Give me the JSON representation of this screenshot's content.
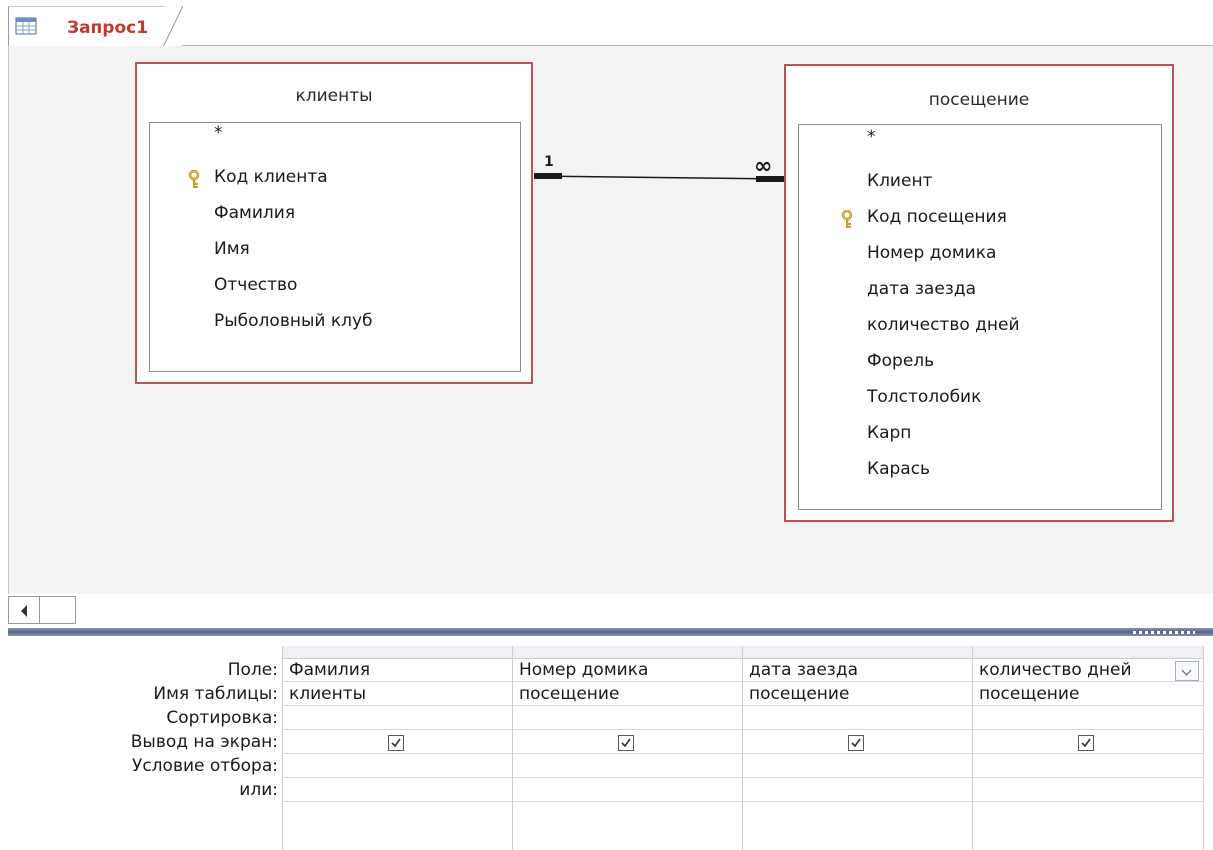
{
  "tab": {
    "title": "Запрос1"
  },
  "tables": {
    "clients": {
      "title": "клиенты",
      "fields": [
        "*",
        "Код клиента",
        "Фамилия",
        "Имя",
        "Отчество",
        "Рыболовный клуб"
      ],
      "key_field": "Код клиента"
    },
    "visits": {
      "title": "посещение",
      "fields": [
        "*",
        "Клиент",
        "Код посещения",
        "Номер домика",
        "дата заезда",
        "количество дней",
        "Форель",
        "Толстолобик",
        "Карп",
        "Карась"
      ],
      "key_field": "Код посещения"
    }
  },
  "relationship": {
    "one_label": "1",
    "many_label": "∞"
  },
  "qbe": {
    "row_labels": [
      "Поле:",
      "Имя таблицы:",
      "Сортировка:",
      "Вывод на экран:",
      "Условие отбора:",
      "или:"
    ],
    "columns": [
      {
        "field": "Фамилия",
        "table": "клиенты",
        "sort": "",
        "show": true,
        "criteria": "",
        "or": ""
      },
      {
        "field": "Номер домика",
        "table": "посещение",
        "sort": "",
        "show": true,
        "criteria": "",
        "or": ""
      },
      {
        "field": "дата заезда",
        "table": "посещение",
        "sort": "",
        "show": true,
        "criteria": "",
        "or": ""
      },
      {
        "field": "количество дней",
        "table": "посещение",
        "sort": "",
        "show": true,
        "criteria": "",
        "or": ""
      }
    ]
  },
  "colors": {
    "table_border": "#b8535a",
    "tab_title": "#c0392b",
    "splitter": "#59638a"
  }
}
